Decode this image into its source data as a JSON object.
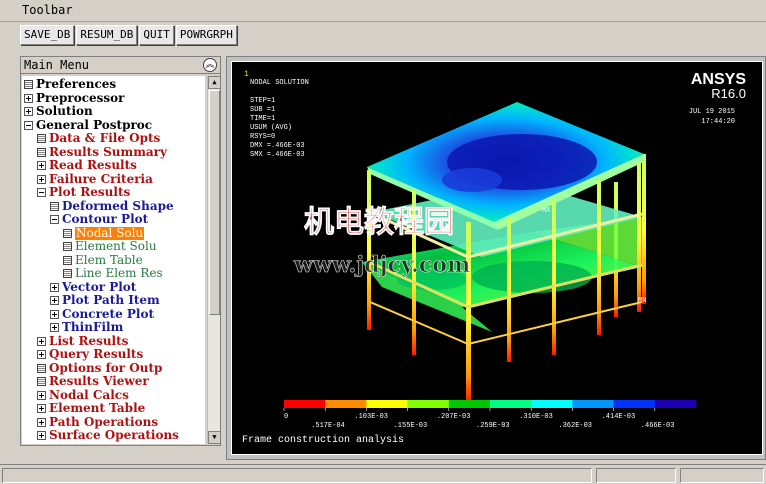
{
  "toolbar": {
    "title": "Toolbar",
    "buttons": [
      "SAVE_DB",
      "RESUM_DB",
      "QUIT",
      "POWRGRPH"
    ]
  },
  "main_menu": {
    "title": "Main Menu",
    "collapse_icon": "double-chevron-up-icon",
    "items": [
      {
        "label": "Preferences",
        "icon": "doc",
        "color": "black",
        "indent": 0
      },
      {
        "label": "Preprocessor",
        "icon": "plus",
        "color": "black",
        "indent": 0
      },
      {
        "label": "Solution",
        "icon": "plus",
        "color": "black",
        "indent": 0
      },
      {
        "label": "General Postproc",
        "icon": "minus",
        "color": "black",
        "indent": 0
      },
      {
        "label": "Data & File Opts",
        "icon": "doc",
        "color": "red",
        "indent": 1
      },
      {
        "label": "Results Summary",
        "icon": "doc",
        "color": "red",
        "indent": 1
      },
      {
        "label": "Read Results",
        "icon": "plus",
        "color": "red",
        "indent": 1
      },
      {
        "label": "Failure Criteria",
        "icon": "plus",
        "color": "red",
        "indent": 1
      },
      {
        "label": "Plot Results",
        "icon": "minus",
        "color": "red",
        "indent": 1
      },
      {
        "label": "Deformed Shape",
        "icon": "doc",
        "color": "blue",
        "indent": 2
      },
      {
        "label": "Contour Plot",
        "icon": "minus",
        "color": "blue",
        "indent": 2
      },
      {
        "label": "Nodal Solu",
        "icon": "doc",
        "color": "green",
        "indent": 3,
        "selected": true
      },
      {
        "label": "Element Solu",
        "icon": "doc",
        "color": "green",
        "indent": 3
      },
      {
        "label": "Elem Table",
        "icon": "doc",
        "color": "green",
        "indent": 3
      },
      {
        "label": "Line Elem Res",
        "icon": "doc",
        "color": "green",
        "indent": 3
      },
      {
        "label": "Vector Plot",
        "icon": "plus",
        "color": "blue",
        "indent": 2
      },
      {
        "label": "Plot Path Item",
        "icon": "plus",
        "color": "blue",
        "indent": 2
      },
      {
        "label": "Concrete Plot",
        "icon": "plus",
        "color": "blue",
        "indent": 2
      },
      {
        "label": "ThinFilm",
        "icon": "plus",
        "color": "blue",
        "indent": 2
      },
      {
        "label": "List Results",
        "icon": "plus",
        "color": "red",
        "indent": 1
      },
      {
        "label": "Query Results",
        "icon": "plus",
        "color": "red",
        "indent": 1
      },
      {
        "label": "Options for Outp",
        "icon": "doc",
        "color": "red",
        "indent": 1
      },
      {
        "label": "Results Viewer",
        "icon": "doc",
        "color": "red",
        "indent": 1
      },
      {
        "label": "Nodal Calcs",
        "icon": "plus",
        "color": "red",
        "indent": 1
      },
      {
        "label": "Element Table",
        "icon": "plus",
        "color": "red",
        "indent": 1
      },
      {
        "label": "Path Operations",
        "icon": "plus",
        "color": "red",
        "indent": 1
      },
      {
        "label": "Surface Operations",
        "icon": "plus",
        "color": "red",
        "indent": 1
      }
    ]
  },
  "graphics": {
    "window_number": "1",
    "info_lines": [
      "NODAL SOLUTION",
      "",
      "STEP=1",
      "SUB =1",
      "TIME=1",
      "USUM       (AVG)",
      "RSYS=0",
      "DMX =.466E-03",
      "SMX =.466E-03"
    ],
    "logo": "ANSYS",
    "version": "R16.0",
    "date": "JUL 19 2015",
    "time": "17:44:20",
    "mx_label": "MX",
    "mn_label": "MN",
    "watermark_cn": "机电教程园",
    "watermark_url": "www.jdjcy.com",
    "caption": "Frame construction analysis",
    "legend_colors": [
      "#ff0000",
      "#ff8c00",
      "#ffff00",
      "#80ff00",
      "#00c800",
      "#00ff80",
      "#00ffff",
      "#0096ff",
      "#0032ff",
      "#1e00b4"
    ],
    "legend_top_labels": [
      "0",
      ".103E-03",
      ".207E-03",
      ".310E-03",
      ".414E-03"
    ],
    "legend_bottom_labels": [
      ".517E-04",
      ".155E-03",
      ".259E-03",
      ".362E-03",
      ".466E-03"
    ]
  }
}
